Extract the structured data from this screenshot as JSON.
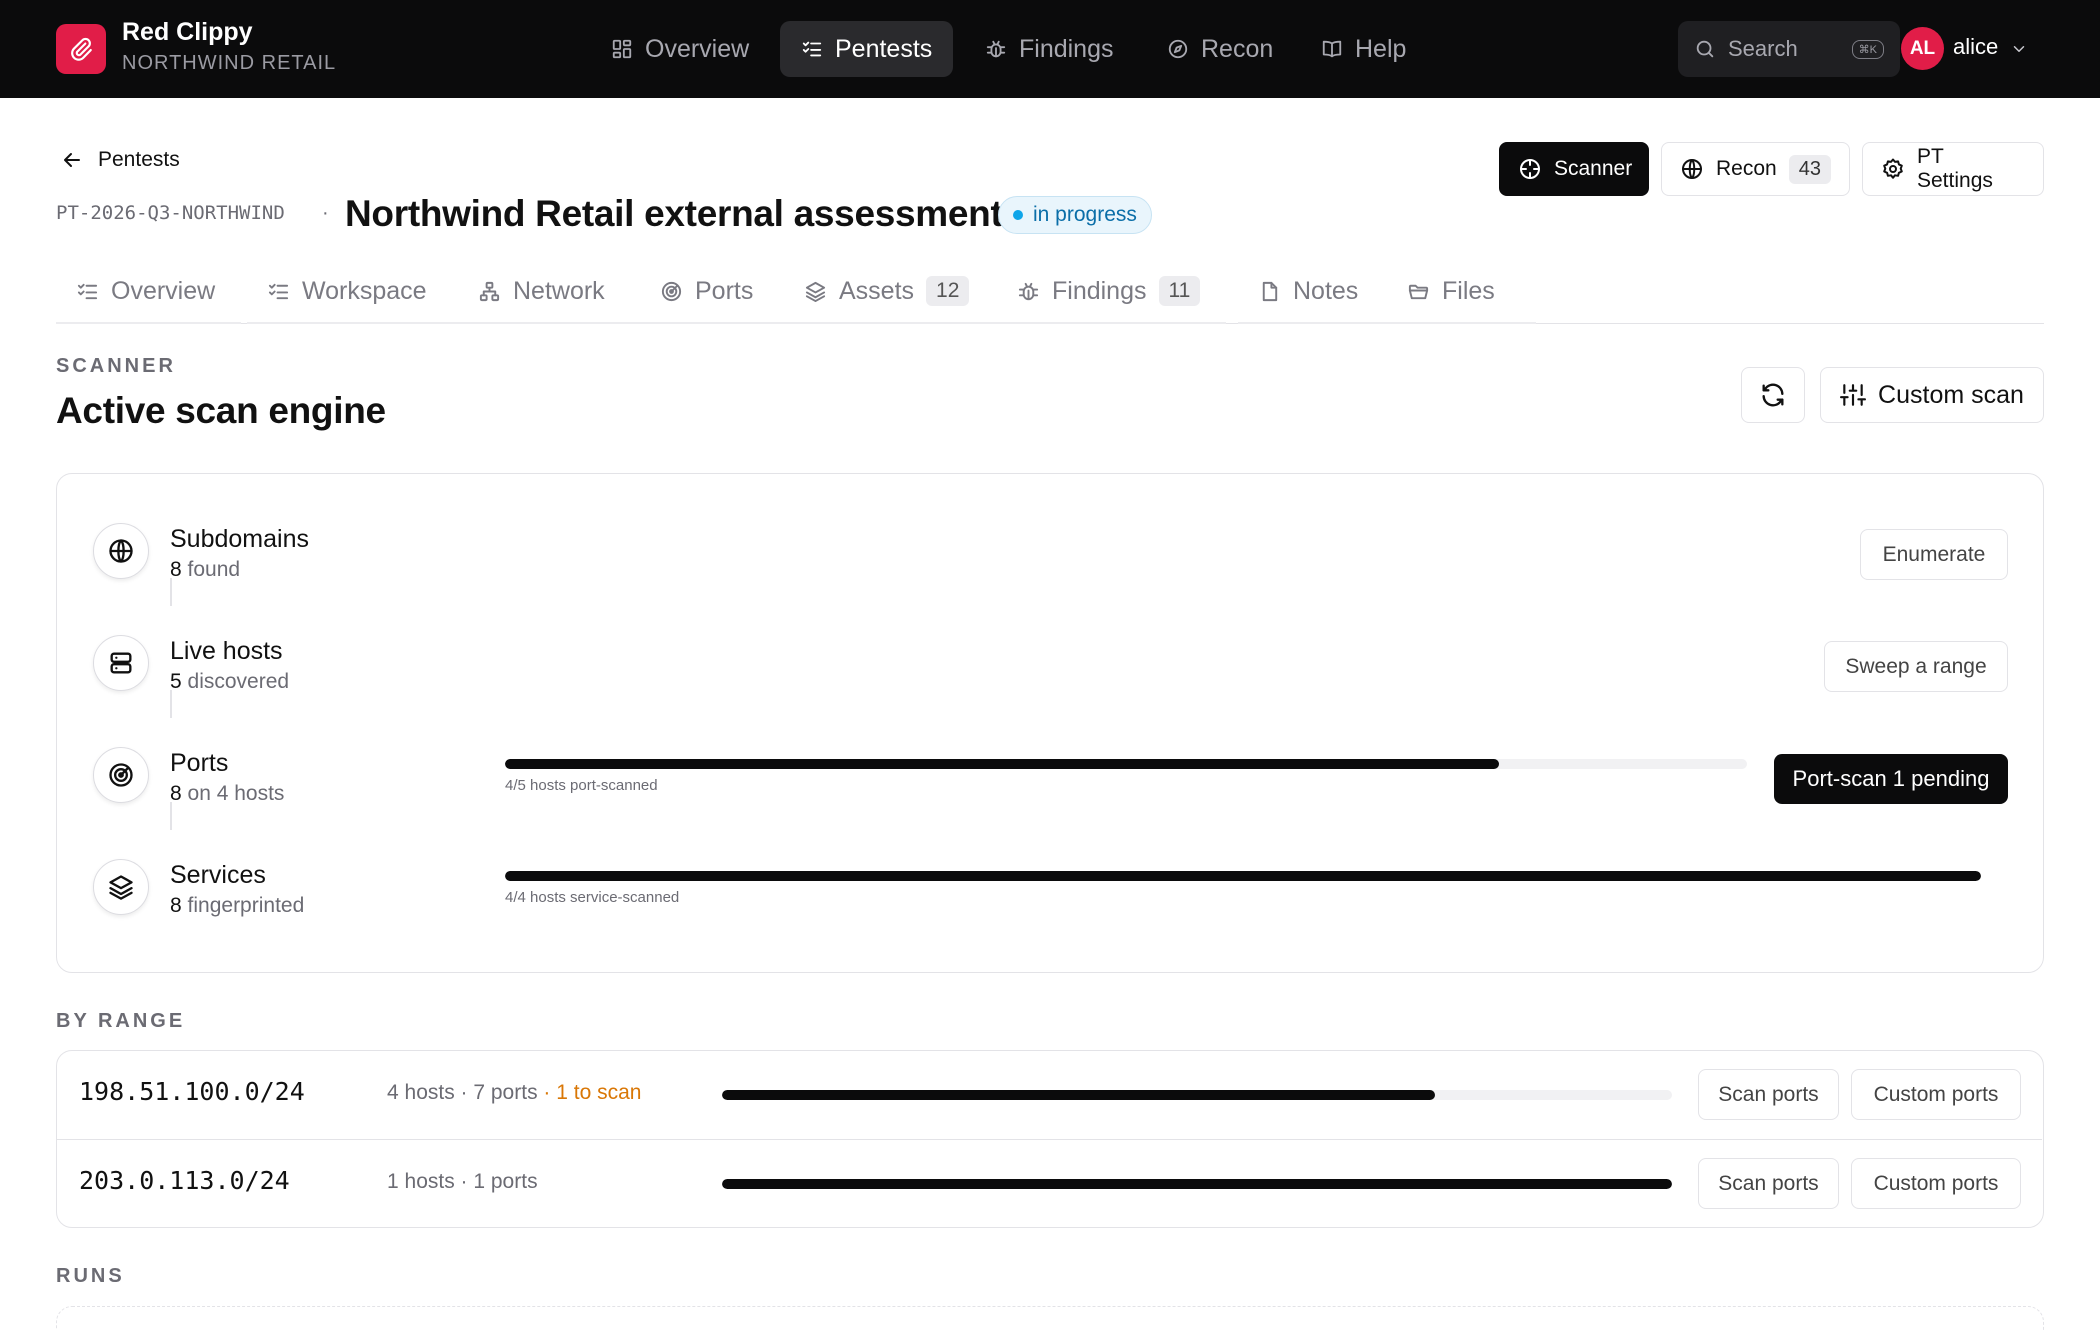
{
  "app": {
    "name": "Red Clippy",
    "org": "NORTHWIND RETAIL",
    "brand_color": "#e11d48"
  },
  "nav": {
    "items": [
      {
        "label": "Overview",
        "icon": "grid-icon",
        "active": false
      },
      {
        "label": "Pentests",
        "icon": "checklist-icon",
        "active": true
      },
      {
        "label": "Findings",
        "icon": "bug-icon",
        "active": false
      },
      {
        "label": "Recon",
        "icon": "compass-icon",
        "active": false
      },
      {
        "label": "Help",
        "icon": "book-icon",
        "active": false
      }
    ],
    "search_label": "Search",
    "search_shortcut": "⌘K",
    "user": {
      "initials": "AL",
      "name": "alice"
    }
  },
  "header": {
    "back_label": "Pentests",
    "pentest_id": "PT-2026-Q3-NORTHWIND",
    "separator": "·",
    "title": "Northwind Retail external assessment",
    "status": "in progress",
    "status_color": "#0ea5e9",
    "actions": {
      "scanner": "Scanner",
      "recon": "Recon",
      "recon_count": "43",
      "settings": "PT Settings"
    }
  },
  "tabs": [
    {
      "label": "Overview",
      "icon": "checklist-icon",
      "count": ""
    },
    {
      "label": "Workspace",
      "icon": "checklist-icon",
      "count": ""
    },
    {
      "label": "Network",
      "icon": "network-icon",
      "count": ""
    },
    {
      "label": "Ports",
      "icon": "radar-icon",
      "count": ""
    },
    {
      "label": "Assets",
      "icon": "layers-icon",
      "count": "12"
    },
    {
      "label": "Findings",
      "icon": "bug-icon",
      "count": "11"
    },
    {
      "label": "Notes",
      "icon": "file-icon",
      "count": ""
    },
    {
      "label": "Files",
      "icon": "folder-icon",
      "count": ""
    }
  ],
  "scanner": {
    "eyebrow": "SCANNER",
    "title": "Active scan engine",
    "custom_scan_label": "Custom scan",
    "stages": [
      {
        "name": "Subdomains",
        "count": "8",
        "suffix": "found",
        "icon": "globe-icon",
        "action": "Enumerate"
      },
      {
        "name": "Live hosts",
        "count": "5",
        "suffix": "discovered",
        "icon": "server-icon",
        "action": "Sweep a range"
      },
      {
        "name": "Ports",
        "count": "8",
        "suffix": "on 4 hosts",
        "icon": "radar-icon",
        "progress_label": "4/5 hosts port-scanned",
        "progress": 0.8,
        "action": "Port-scan 1 pending"
      },
      {
        "name": "Services",
        "count": "8",
        "suffix": "fingerprinted",
        "icon": "layers-icon",
        "progress_label": "4/4 hosts service-scanned",
        "progress": 1.0
      }
    ]
  },
  "by_range": {
    "eyebrow": "BY RANGE",
    "warn_color": "#d97706",
    "rows": [
      {
        "cidr": "198.51.100.0/24",
        "meta": "4 hosts · 7 ports",
        "pending": " · 1 to scan",
        "progress": 0.75,
        "scan_label": "Scan ports",
        "custom_label": "Custom ports"
      },
      {
        "cidr": "203.0.113.0/24",
        "meta": "1 hosts · 1 ports",
        "pending": "",
        "progress": 1.0,
        "scan_label": "Scan ports",
        "custom_label": "Custom ports"
      }
    ]
  },
  "runs": {
    "eyebrow": "RUNS"
  }
}
